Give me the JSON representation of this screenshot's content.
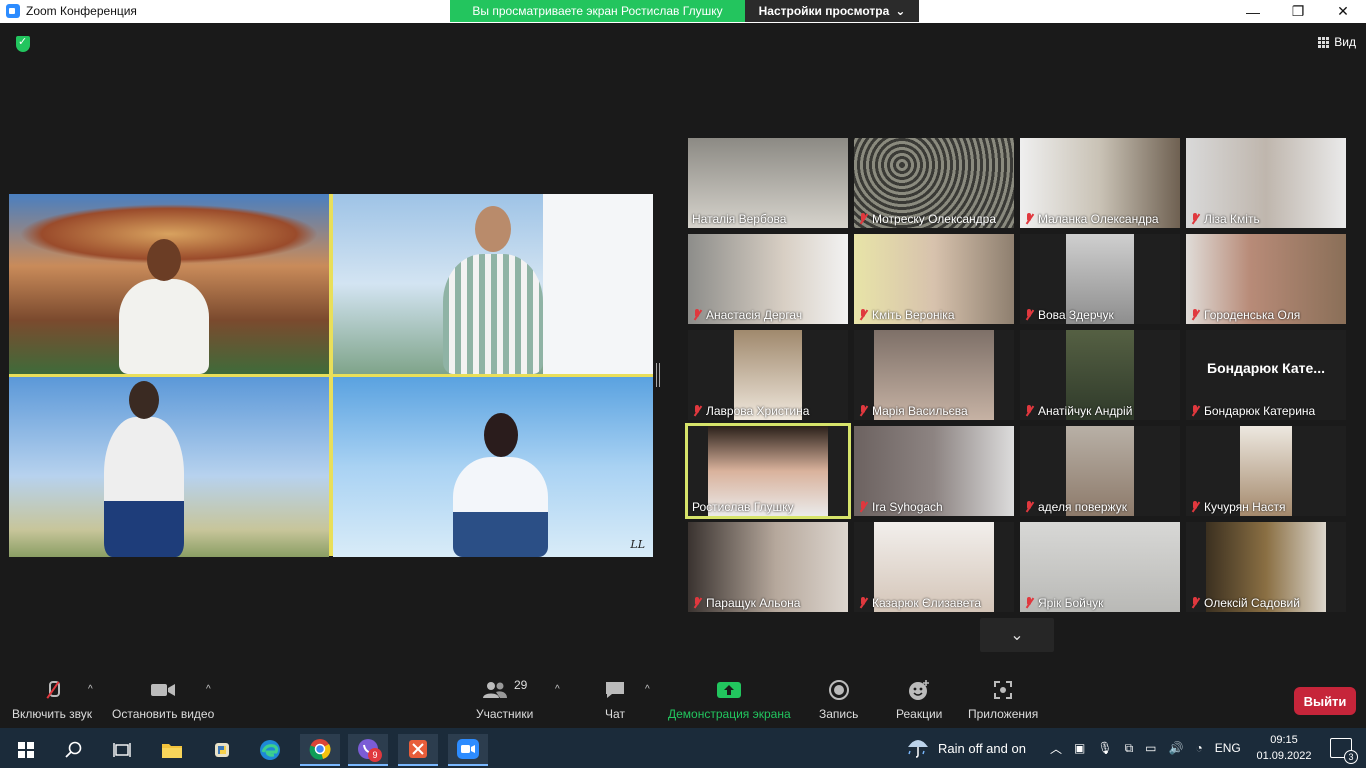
{
  "window": {
    "title": "Zoom Конференция",
    "minimize": "—",
    "restore": "❐",
    "close": "✕"
  },
  "share_banner": {
    "viewing_text": "Вы просматриваете экран Ростислав Глушку",
    "view_options": "Настройки просмотра",
    "chevron": "⌄"
  },
  "view": {
    "label": "Вид"
  },
  "shared_screen": {
    "watermark": "LL"
  },
  "participants": [
    {
      "name": "Наталія Вербова",
      "muted": false
    },
    {
      "name": "Мотреску Олександра",
      "muted": true
    },
    {
      "name": "Маланка Олександра",
      "muted": true
    },
    {
      "name": "Ліза Кміть",
      "muted": true
    },
    {
      "name": "Анастасія Дергач",
      "muted": true
    },
    {
      "name": "Кміть Вероніка",
      "muted": true
    },
    {
      "name": "Вова Здерчук",
      "muted": true
    },
    {
      "name": "Городенська Оля",
      "muted": true
    },
    {
      "name": "Лаврова Христина",
      "muted": true
    },
    {
      "name": "Марія Васильєва",
      "muted": true
    },
    {
      "name": "Анатійчук Андрій",
      "muted": true
    },
    {
      "name": "Бондарюк Катерина",
      "muted": true,
      "no_video_label": "Бондарюк  Кате..."
    },
    {
      "name": "Ростислав Глушку",
      "muted": false,
      "active_speaker": true
    },
    {
      "name": "Ira Syhogach",
      "muted": true
    },
    {
      "name": "аделя повержук",
      "muted": true
    },
    {
      "name": "Кучурян Настя",
      "muted": true
    },
    {
      "name": "Паращук Альона",
      "muted": true
    },
    {
      "name": "Казарюк Єлизавета",
      "muted": true
    },
    {
      "name": "Ярік Бойчук",
      "muted": true
    },
    {
      "name": "Олексій Садовий",
      "muted": true
    }
  ],
  "toolbar": {
    "unmute": "Включить звук",
    "stop_video": "Остановить видео",
    "participants": "Участники",
    "participants_count": "29",
    "chat": "Чат",
    "share_screen": "Демонстрация экрана",
    "record": "Запись",
    "reactions": "Реакции",
    "apps": "Приложения",
    "leave": "Выйти",
    "caret": "^",
    "more_chevron": "⌄"
  },
  "taskbar": {
    "weather": "Rain off and on",
    "language": "ENG",
    "time": "09:15",
    "date": "01.09.2022",
    "viber_badge": "9",
    "notif_count": "3"
  },
  "colors": {
    "accent_green": "#22c55e",
    "leave_red": "#c6253a",
    "active_speaker_border": "#d6e36a",
    "muted_red": "#e0383e"
  }
}
